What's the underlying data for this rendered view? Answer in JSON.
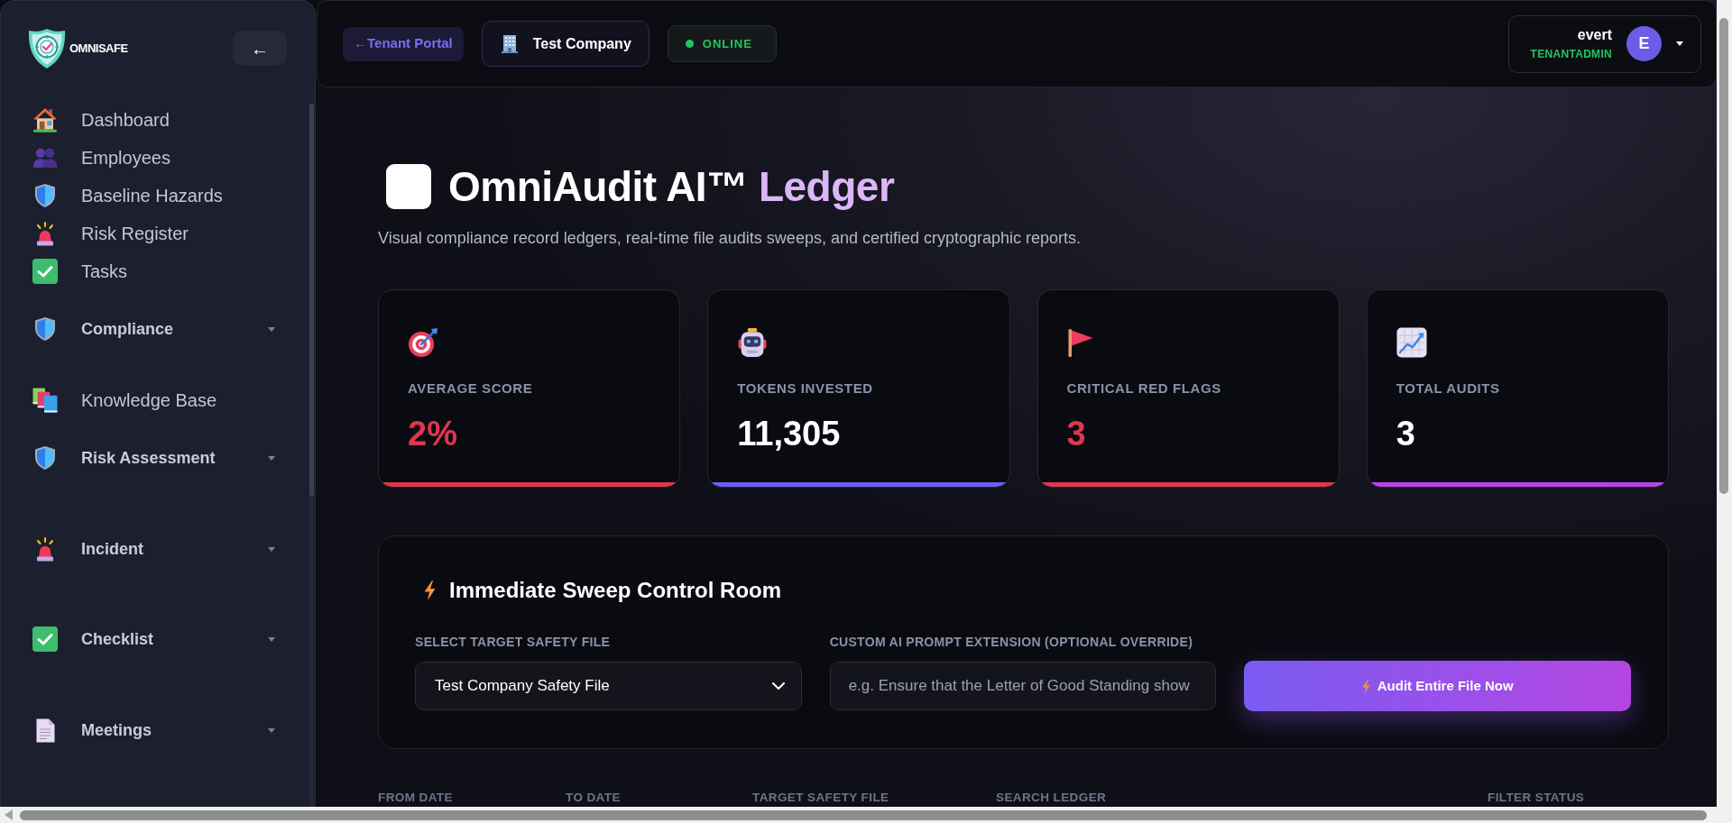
{
  "sidebar": {
    "logo_text": "OMNISAFE",
    "collapse_button": "←",
    "items": [
      {
        "label": "Dashboard",
        "kind": "link"
      },
      {
        "label": "Employees",
        "kind": "link"
      },
      {
        "label": "Baseline Hazards",
        "kind": "link"
      },
      {
        "label": "Risk Register",
        "kind": "link"
      },
      {
        "label": "Tasks",
        "kind": "link"
      },
      {
        "label": "Compliance",
        "kind": "group"
      },
      {
        "label": "Knowledge Base",
        "kind": "link"
      },
      {
        "label": "Risk Assessment",
        "kind": "group"
      },
      {
        "label": "Incident",
        "kind": "group"
      },
      {
        "label": "Checklist",
        "kind": "group"
      },
      {
        "label": "Meetings",
        "kind": "group"
      }
    ]
  },
  "top_bar": {
    "back_link": "←Tenant Portal",
    "company": "Test Company",
    "status": "ONLINE",
    "user": {
      "name": "evert",
      "role": "TENANTADMIN",
      "initial": "E"
    }
  },
  "header": {
    "title": "OmniAudit AI™",
    "title_accent": "Ledger",
    "subtitle": "Visual compliance record ledgers, real-time file audits sweeps, and certified cryptographic reports."
  },
  "stats": [
    {
      "label": "AVERAGE SCORE",
      "value": "2%",
      "color": "#e0364f",
      "alert": true
    },
    {
      "label": "TOKENS INVESTED",
      "value": "11,305",
      "color": "#6a5ff0",
      "alert": false
    },
    {
      "label": "CRITICAL RED FLAGS",
      "value": "3",
      "color": "#e0364f",
      "alert": true
    },
    {
      "label": "TOTAL AUDITS",
      "value": "3",
      "color": "#b445e6",
      "alert": false
    }
  ],
  "sweep_panel": {
    "title": "Immediate Sweep Control Room",
    "file_label": "SELECT TARGET SAFETY FILE",
    "file_value": "Test Company Safety File",
    "prompt_label": "CUSTOM AI PROMPT EXTENSION (OPTIONAL OVERRIDE)",
    "prompt_placeholder": "e.g. Ensure that the Letter of Good Standing show",
    "button": "Audit Entire File Now"
  },
  "ledger_filters": [
    {
      "label": "FROM DATE"
    },
    {
      "label": "TO DATE"
    },
    {
      "label": "TARGET SAFETY FILE"
    },
    {
      "label": "SEARCH LEDGER"
    },
    {
      "label": "FILTER STATUS"
    }
  ]
}
